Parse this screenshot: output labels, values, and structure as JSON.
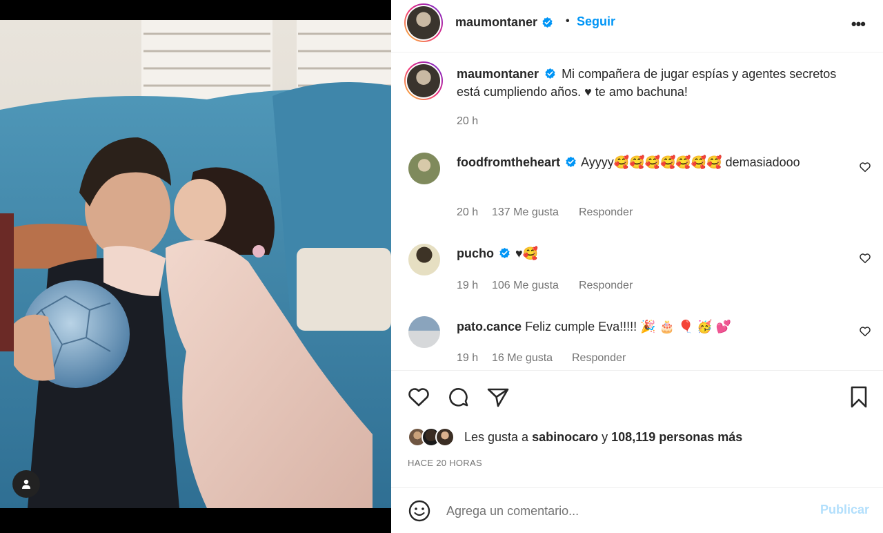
{
  "post": {
    "author": "maumontaner",
    "follow_label": "Seguir",
    "separator": "•",
    "more_label": "•••",
    "caption": "Mi compañera de jugar espías y agentes secretos está cumpliendo años. ♥ te amo bachuna!",
    "caption_time": "20 h"
  },
  "comments": [
    {
      "user": "foodfromtheheart",
      "verified": true,
      "text": "Ayyyy🥰🥰🥰🥰🥰🥰🥰 demasiadooo",
      "time": "20 h",
      "likes": "137 Me gusta",
      "reply": "Responder"
    },
    {
      "user": "pucho",
      "verified": true,
      "text": "♥🥰",
      "time": "19 h",
      "likes": "106 Me gusta",
      "reply": "Responder"
    },
    {
      "user": "pato.cance",
      "verified": false,
      "text": "Feliz cumple Eva!!!!! 🎉 🎂 🎈 🥳 💕",
      "time": "19 h",
      "likes": "16 Me gusta",
      "reply": "Responder"
    }
  ],
  "likes": {
    "prefix": "Les gusta a",
    "first_user": "sabinocaro",
    "conj": "y",
    "count": "108,119 personas más"
  },
  "posted_ago": "HACE 20 HORAS",
  "add_comment": {
    "placeholder": "Agrega un comentario...",
    "publish_label": "Publicar"
  },
  "colors": {
    "accent": "#0095f6",
    "publish_disabled": "#b2dffc",
    "secondary_text": "#737373"
  },
  "icons": [
    "verified-icon",
    "heart-icon",
    "comment-icon",
    "share-icon",
    "bookmark-icon",
    "emoji-icon",
    "user-tag-icon",
    "more-icon"
  ]
}
